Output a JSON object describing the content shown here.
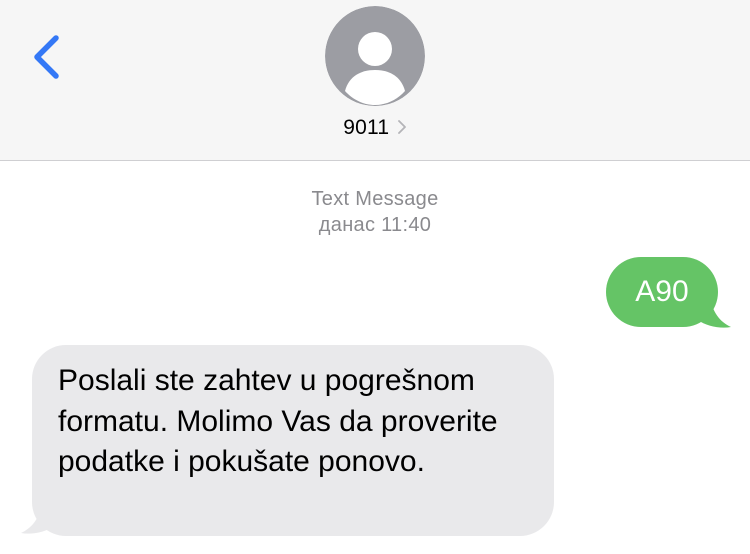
{
  "header": {
    "back_icon": "chevron-left-icon",
    "avatar_icon": "person-icon",
    "contact_name": "9011",
    "contact_chevron_icon": "chevron-right-icon"
  },
  "conversation": {
    "service_label": "Text Message",
    "timestamp": "данас 11:40",
    "messages": [
      {
        "direction": "outgoing",
        "text": "A90"
      },
      {
        "direction": "incoming",
        "text": "Poslali ste zahtev u pogrešnom formatu. Molimo Vas da proverite podatke i pokušate ponovo."
      }
    ]
  },
  "colors": {
    "accent_blue": "#3478f6",
    "outgoing_bubble": "#65c466",
    "incoming_bubble": "#e9e9eb",
    "header_background": "#f6f6f6",
    "meta_text": "#8a8a8e",
    "avatar_background": "#9c9da3"
  }
}
